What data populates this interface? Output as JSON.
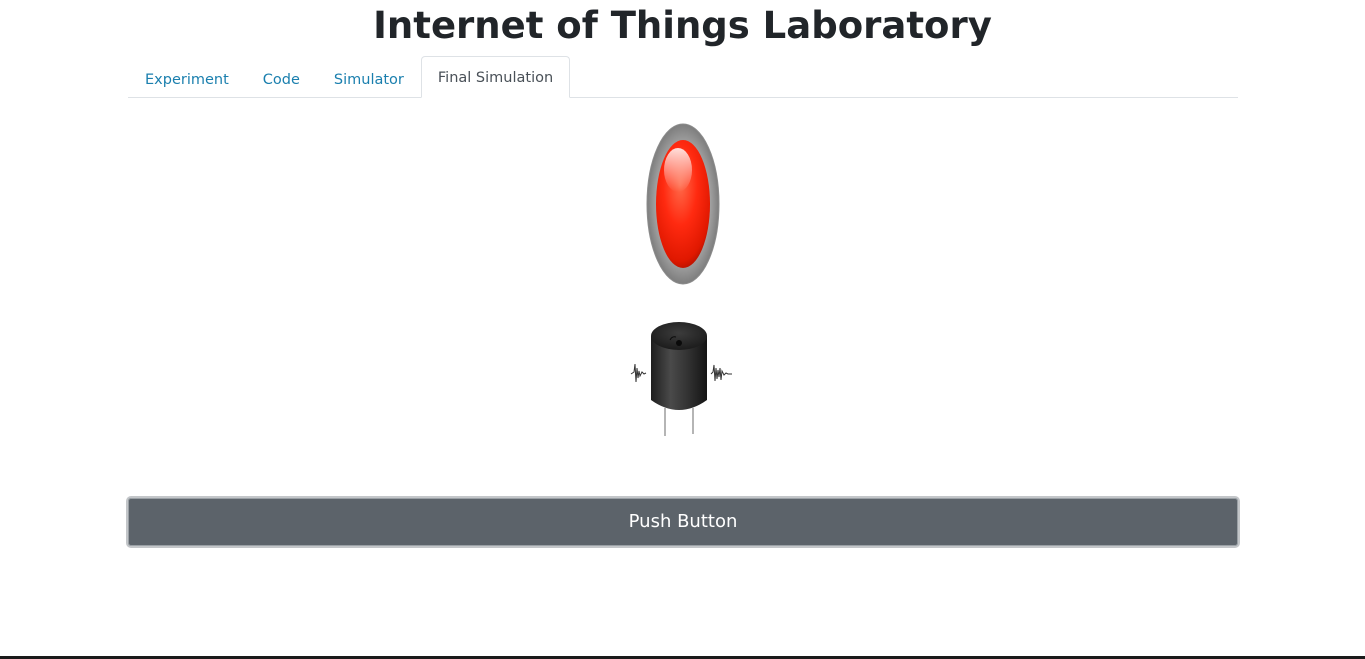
{
  "header": {
    "title": "Internet of Things Laboratory"
  },
  "tabs": [
    {
      "label": "Experiment",
      "active": false
    },
    {
      "label": "Code",
      "active": false
    },
    {
      "label": "Simulator",
      "active": false
    },
    {
      "label": "Final Simulation",
      "active": true
    }
  ],
  "simulation": {
    "led_icon": "red-led-icon",
    "led_color": "#ff2200",
    "buzzer_icon": "buzzer-icon"
  },
  "controls": {
    "push_button_label": "Push Button"
  },
  "colors": {
    "tab_link": "#1a7fae",
    "button_bg": "#5c636a"
  }
}
